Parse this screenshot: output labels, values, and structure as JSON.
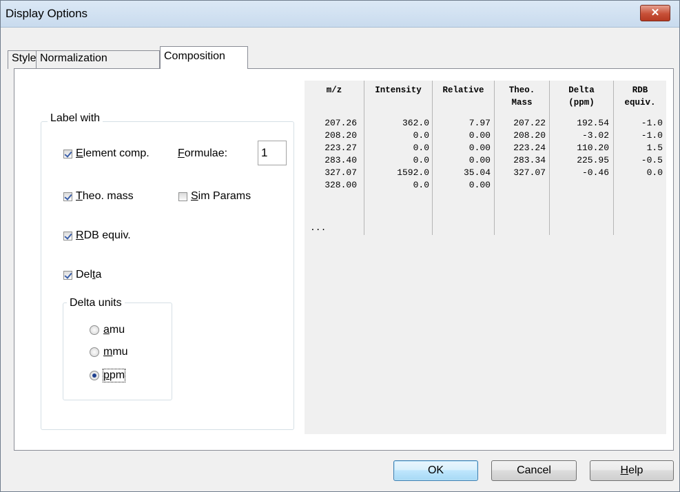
{
  "window": {
    "title": "Display Options",
    "close_label": "✕"
  },
  "tabs": [
    {
      "label": "Style",
      "active": false
    },
    {
      "label": "Normalization",
      "active": false
    },
    {
      "label": "Composition",
      "active": true
    }
  ],
  "label_with": {
    "title": "Label with",
    "element_comp": {
      "label_pre": "",
      "label_u": "E",
      "label_post": "lement comp.",
      "checked": true
    },
    "formulae": {
      "label_u": "F",
      "label_post": "ormulae:",
      "value": "1"
    },
    "theo_mass": {
      "label_u": "T",
      "label_post": "heo. mass",
      "checked": true
    },
    "sim_params": {
      "label_u": "S",
      "label_post": "im Params",
      "checked": false
    },
    "rdb_equiv": {
      "label_u": "R",
      "label_post": "DB equiv.",
      "checked": true
    },
    "delta": {
      "label_pre": "Del",
      "label_u": "t",
      "label_post": "a",
      "checked": true
    }
  },
  "delta_units": {
    "title": "Delta units",
    "options": [
      {
        "label_u": "a",
        "label_post": "mu",
        "selected": false
      },
      {
        "label_u": "m",
        "label_post": "mu",
        "selected": false
      },
      {
        "label_u": "p",
        "label_post": "pm",
        "selected": true
      }
    ]
  },
  "composition_table": {
    "headers": [
      [
        "m/z",
        ""
      ],
      [
        "Intensity",
        ""
      ],
      [
        "Relative",
        ""
      ],
      [
        "Theo.",
        "Mass"
      ],
      [
        "Delta",
        "(ppm)"
      ],
      [
        "RDB",
        "equiv."
      ]
    ],
    "rows": [
      [
        "207.26",
        "362.0",
        "7.97",
        "207.22",
        "192.54",
        "-1.0"
      ],
      [
        "208.20",
        "0.0",
        "0.00",
        "208.20",
        "-3.02",
        "-1.0"
      ],
      [
        "223.27",
        "0.0",
        "0.00",
        "223.24",
        "110.20",
        "1.5"
      ],
      [
        "283.40",
        "0.0",
        "0.00",
        "283.34",
        "225.95",
        "-0.5"
      ],
      [
        "327.07",
        "1592.0",
        "35.04",
        "327.07",
        "-0.46",
        "0.0"
      ],
      [
        "328.00",
        "0.0",
        "0.00",
        "",
        "",
        ""
      ]
    ],
    "ellipsis": "..."
  },
  "buttons": {
    "ok": "OK",
    "cancel": "Cancel",
    "help_u": "H",
    "help_post": "elp"
  }
}
